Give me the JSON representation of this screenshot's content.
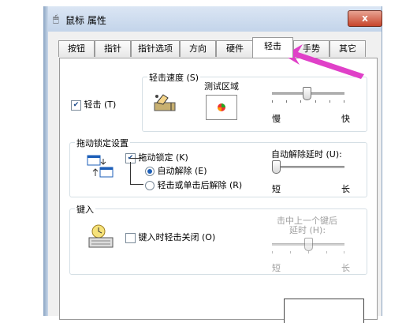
{
  "window": {
    "title": "鼠标 属性",
    "close": "x"
  },
  "tabs": [
    "按钮",
    "指针",
    "指针选项",
    "方向",
    "硬件",
    "轻击",
    "手势",
    "其它"
  ],
  "active_tab": "轻击",
  "tap": {
    "checkbox_label": "轻击 (T)",
    "speed_group": "轻击速度 (S)",
    "test_area": "测试区域",
    "slow": "慢",
    "fast": "快",
    "speed_level": 0.48
  },
  "drag_lock": {
    "group": "拖动锁定设置",
    "checkbox_label": "拖动锁定 (K)",
    "auto_release": "自动解除 (E)",
    "tap_release": "轻击或单击后解除 (R)",
    "delay_label": "自动解除延时 (U):",
    "short": "短",
    "long": "长",
    "delay_level": 0.0
  },
  "key_in": {
    "group": "键入",
    "checkbox_label": "键入时轻击关闭 (O)",
    "delay_label_1": "击中上一个键后",
    "delay_label_2": "延时 (H):",
    "short": "短",
    "long": "长",
    "delay_level": 0.5
  },
  "colors": {
    "arrow": "#e040c8",
    "accent": "#1d5fb8"
  }
}
